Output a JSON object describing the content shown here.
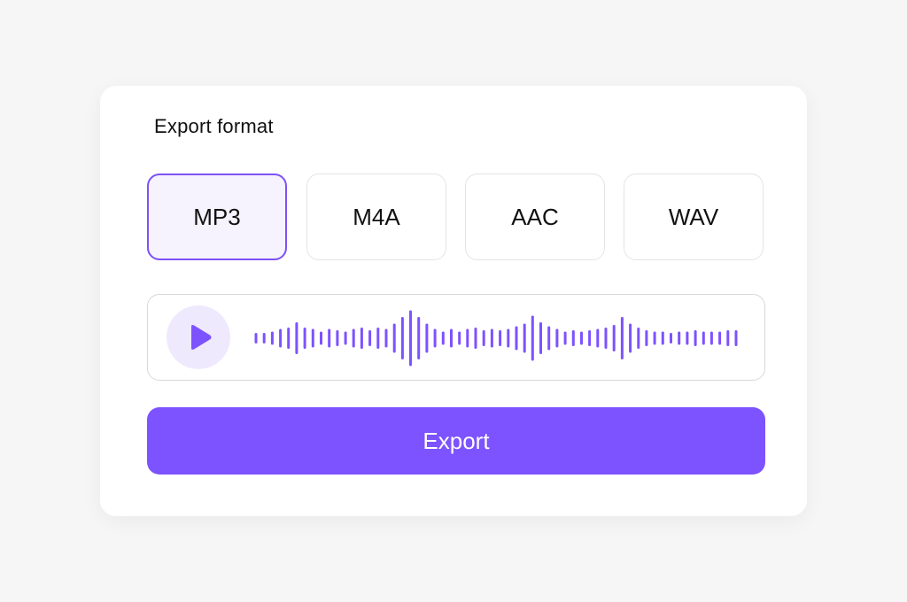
{
  "panel": {
    "title": "Export format"
  },
  "formats": [
    {
      "label": "MP3",
      "selected": true
    },
    {
      "label": "M4A",
      "selected": false
    },
    {
      "label": "AAC",
      "selected": false
    },
    {
      "label": "WAV",
      "selected": false
    }
  ],
  "player": {
    "play_icon": "play-icon",
    "waveform_levels": [
      0.15,
      0.15,
      0.2,
      0.3,
      0.35,
      0.55,
      0.35,
      0.3,
      0.2,
      0.3,
      0.25,
      0.2,
      0.3,
      0.35,
      0.25,
      0.35,
      0.3,
      0.5,
      0.75,
      1.0,
      0.75,
      0.5,
      0.3,
      0.2,
      0.3,
      0.2,
      0.3,
      0.35,
      0.25,
      0.3,
      0.25,
      0.3,
      0.4,
      0.5,
      0.8,
      0.55,
      0.4,
      0.3,
      0.2,
      0.25,
      0.2,
      0.25,
      0.3,
      0.35,
      0.45,
      0.75,
      0.5,
      0.35,
      0.25,
      0.2,
      0.2,
      0.15,
      0.2,
      0.2,
      0.25,
      0.2,
      0.2,
      0.2,
      0.25,
      0.25
    ]
  },
  "export": {
    "label": "Export"
  },
  "colors": {
    "accent": "#7d52ff",
    "selected_border": "#7d52f4",
    "selected_bg": "#f6f2fe",
    "play_bg": "#efe9fe",
    "waveform": "#7d52ff"
  }
}
